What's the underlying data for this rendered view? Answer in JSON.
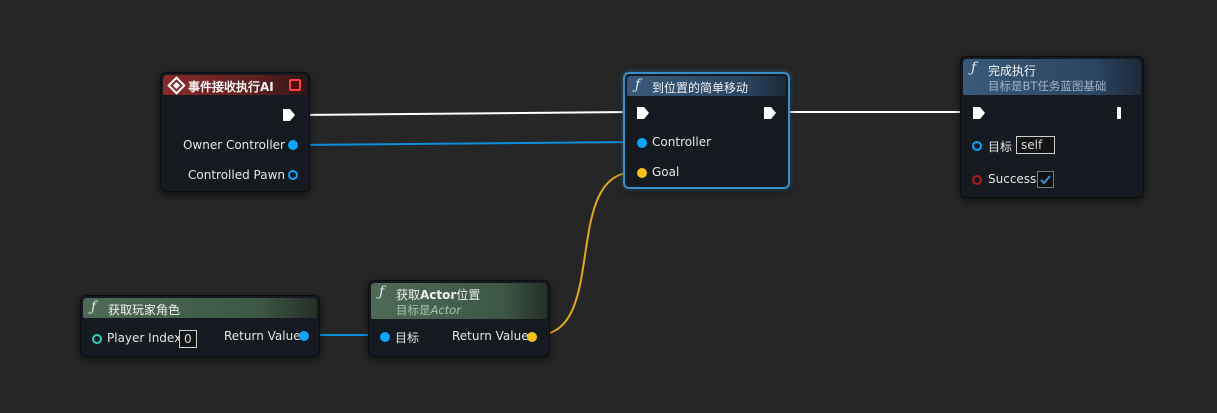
{
  "nodes": {
    "event": {
      "title": "事件接收执行AI",
      "pins": {
        "owner": "Owner Controller",
        "pawn": "Controlled Pawn"
      }
    },
    "move": {
      "title": "到位置的简单移动",
      "pins": {
        "controller": "Controller",
        "goal": "Goal"
      }
    },
    "finish": {
      "title": "完成执行",
      "subtitle": "目标是BT任务蓝图基础",
      "pins": {
        "target": "目标",
        "target_value": "self",
        "success": "Success"
      },
      "success_checked": true
    },
    "get_player": {
      "title": "获取玩家角色",
      "pins": {
        "player_index": "Player Index",
        "player_index_value": "0",
        "return": "Return Value"
      }
    },
    "get_location": {
      "title_prefix": "获取",
      "title_bold": "Actor",
      "title_suffix": "位置",
      "subtitle_prefix": "目标是",
      "subtitle_italic": "Actor",
      "pins": {
        "target": "目标",
        "return": "Return Value"
      }
    }
  },
  "colors": {
    "background": "#262626",
    "exec_wire": "#ffffff",
    "object_wire": "#0aa4ff",
    "vector_wire": "#f5c01a",
    "event_header": "#8a2a2a",
    "function_header": "#3a5a7a",
    "pure_header": "#4e6a56"
  },
  "icons": [
    "event-diamond-icon",
    "delegate-icon",
    "function-icon",
    "exec-pin-icon",
    "checkmark-icon"
  ]
}
